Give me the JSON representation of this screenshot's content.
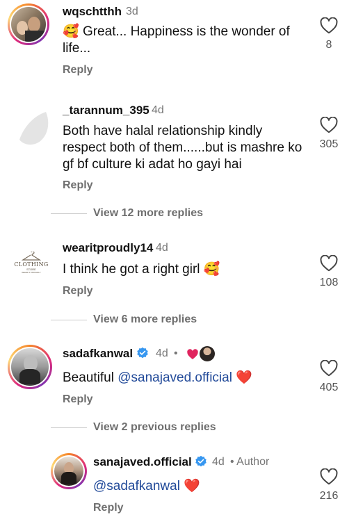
{
  "comments": [
    {
      "username": "wqschtthh",
      "time": "3d",
      "emoji": "🥰",
      "text": "Great... Happiness is the wonder of life...",
      "reply_label": "Reply",
      "likes": "8"
    },
    {
      "username": "_tarannum_395",
      "time": "4d",
      "text": "Both have halal relationship kindly respect both of them......but is mashre ko gf bf culture ki adat ho gayi hai",
      "reply_label": "Reply",
      "likes": "305",
      "more_replies": "View 12 more replies"
    },
    {
      "username": "wearitproudly14",
      "time": "4d",
      "text": "I think he got a right girl",
      "emoji": "🥰",
      "reply_label": "Reply",
      "likes": "108",
      "more_replies": "View 6 more replies",
      "avatar_logo": {
        "line1": "CLOTHING",
        "line2": "STORE",
        "line3": "WEAR IT PROUDLY"
      }
    },
    {
      "username": "sadafkanwal",
      "time": "4d",
      "dot": "•",
      "text": "Beautiful ",
      "mention": "@sanajaved.official",
      "emoji": "❤️",
      "reply_label": "Reply",
      "likes": "405",
      "previous_replies": "View 2 previous replies"
    },
    {
      "username": "sanajaved.official",
      "time": "4d",
      "author_label": "• Author",
      "mention": "@sadafkanwal",
      "emoji": "❤️",
      "reply_label": "Reply",
      "likes": "216"
    }
  ],
  "colors": {
    "mention": "#224a99",
    "verified": "#3797f0",
    "heart_red": "#e0245e",
    "secondary_text": "#6f6f6f"
  },
  "icons": [
    "heart-outline-icon",
    "verified-badge-icon",
    "liked-by-creator-heart-icon"
  ]
}
